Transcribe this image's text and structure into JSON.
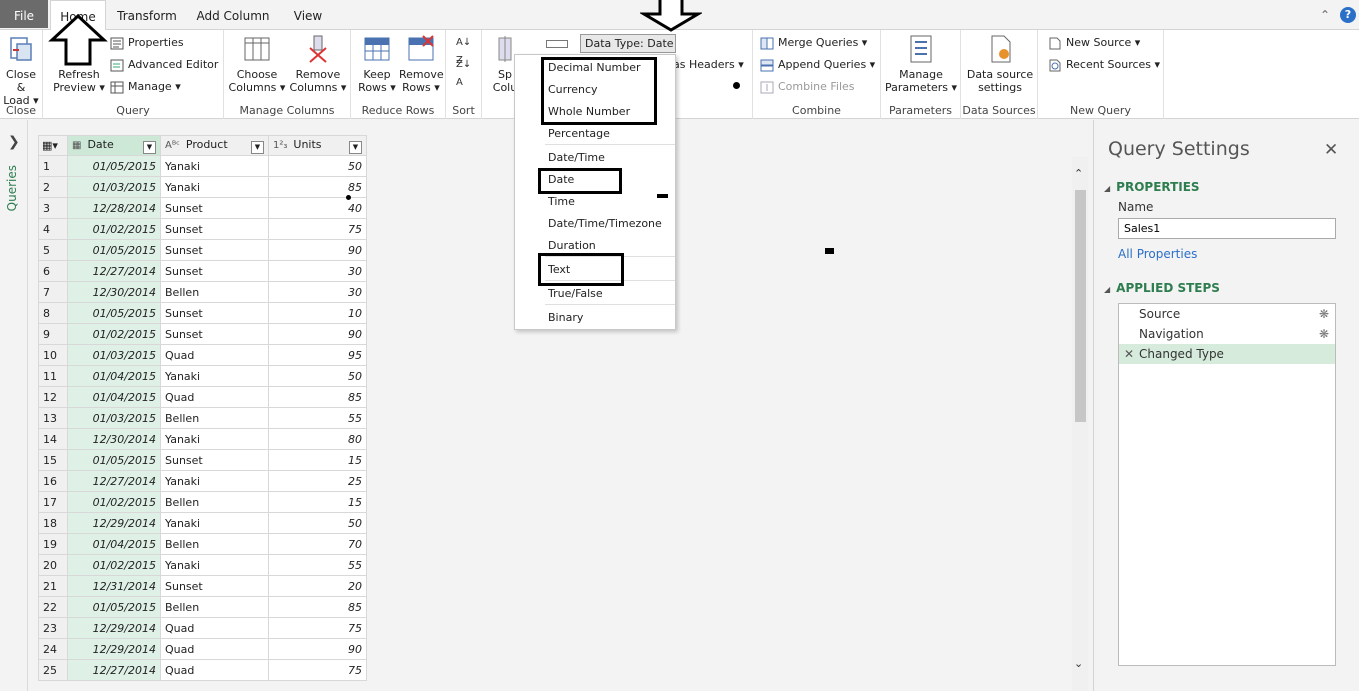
{
  "tabs": {
    "file": "File",
    "home": "Home",
    "transform": "Transform",
    "add_column": "Add Column",
    "view": "View"
  },
  "ribbon": {
    "close_load": "Close &",
    "close_load2": "Load",
    "refresh": "Refresh",
    "refresh2": "Preview",
    "properties": "Properties",
    "advanced_editor": "Advanced Editor",
    "manage": "Manage",
    "choose_columns": "Choose",
    "choose_columns2": "Columns",
    "remove_columns": "Remove",
    "remove_columns2": "Columns",
    "keep_rows": "Keep",
    "keep_rows2": "Rows",
    "remove_rows": "Remove",
    "remove_rows2": "Rows",
    "split": "Sp",
    "split2": "Colu",
    "data_type": "Data Type: Date",
    "headers": "as Headers",
    "merge": "Merge Queries",
    "append": "Append Queries",
    "combine_files": "Combine Files",
    "manage_params": "Manage",
    "manage_params2": "Parameters",
    "ds_settings": "Data source",
    "ds_settings2": "settings",
    "new_source": "New Source",
    "recent_sources": "Recent Sources",
    "groups": {
      "close": "Close",
      "query": "Query",
      "manage_columns": "Manage Columns",
      "reduce_rows": "Reduce Rows",
      "sort": "Sort",
      "combine": "Combine",
      "parameters": "Parameters",
      "data_sources": "Data Sources",
      "new_query": "New Query"
    }
  },
  "dtype_menu": {
    "items": [
      "Decimal Number",
      "Currency",
      "Whole Number",
      "Percentage",
      "Date/Time",
      "Date",
      "Time",
      "Date/Time/Timezone",
      "Duration",
      "Text",
      "True/False",
      "Binary"
    ]
  },
  "queries_label": "Queries",
  "grid": {
    "headers": {
      "date": "Date",
      "product": "Product",
      "units": "Units",
      "date_type": "▦",
      "product_type": "Aᴮᶜ",
      "units_type": "1²₃"
    },
    "rows": [
      [
        "1",
        "01/05/2015",
        "Yanaki",
        "50"
      ],
      [
        "2",
        "01/03/2015",
        "Yanaki",
        "85"
      ],
      [
        "3",
        "12/28/2014",
        "Sunset",
        "40"
      ],
      [
        "4",
        "01/02/2015",
        "Sunset",
        "75"
      ],
      [
        "5",
        "01/05/2015",
        "Sunset",
        "90"
      ],
      [
        "6",
        "12/27/2014",
        "Sunset",
        "30"
      ],
      [
        "7",
        "12/30/2014",
        "Bellen",
        "30"
      ],
      [
        "8",
        "01/05/2015",
        "Sunset",
        "10"
      ],
      [
        "9",
        "01/02/2015",
        "Sunset",
        "90"
      ],
      [
        "10",
        "01/03/2015",
        "Quad",
        "95"
      ],
      [
        "11",
        "01/04/2015",
        "Yanaki",
        "50"
      ],
      [
        "12",
        "01/04/2015",
        "Quad",
        "85"
      ],
      [
        "13",
        "01/03/2015",
        "Bellen",
        "55"
      ],
      [
        "14",
        "12/30/2014",
        "Yanaki",
        "80"
      ],
      [
        "15",
        "01/05/2015",
        "Sunset",
        "15"
      ],
      [
        "16",
        "12/27/2014",
        "Yanaki",
        "25"
      ],
      [
        "17",
        "01/02/2015",
        "Bellen",
        "15"
      ],
      [
        "18",
        "12/29/2014",
        "Yanaki",
        "50"
      ],
      [
        "19",
        "01/04/2015",
        "Bellen",
        "70"
      ],
      [
        "20",
        "01/02/2015",
        "Yanaki",
        "55"
      ],
      [
        "21",
        "12/31/2014",
        "Sunset",
        "20"
      ],
      [
        "22",
        "01/05/2015",
        "Bellen",
        "85"
      ],
      [
        "23",
        "12/29/2014",
        "Quad",
        "75"
      ],
      [
        "24",
        "12/29/2014",
        "Quad",
        "90"
      ],
      [
        "25",
        "12/27/2014",
        "Quad",
        "75"
      ]
    ]
  },
  "query_settings": {
    "title": "Query Settings",
    "properties": "PROPERTIES",
    "name_label": "Name",
    "name_value": "Sales1",
    "all_properties": "All Properties",
    "applied_steps": "APPLIED STEPS",
    "steps": [
      "Source",
      "Navigation",
      "Changed Type"
    ]
  }
}
